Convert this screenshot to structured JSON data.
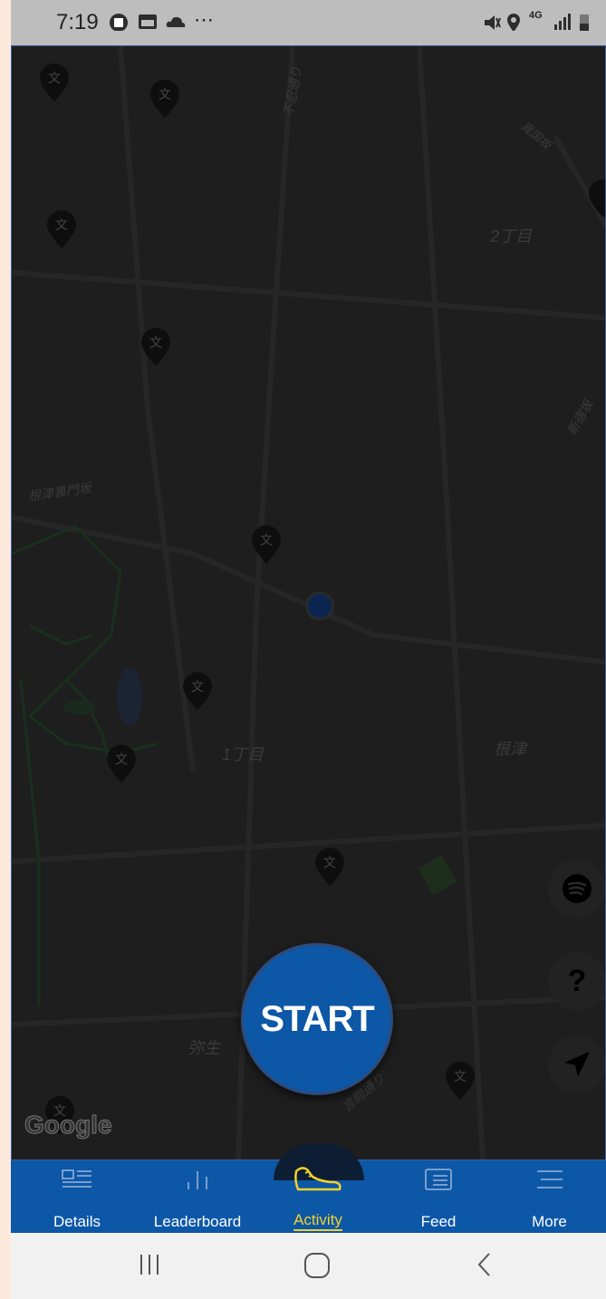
{
  "status_bar": {
    "time": "7:19",
    "net": "4G"
  },
  "map": {
    "labels": [
      "2丁目",
      "根津裏門坂",
      "1丁目",
      "根津",
      "弥生",
      "言問通り",
      "不忍通り",
      "新宿坂",
      "異国坂"
    ],
    "attribution": "Google"
  },
  "start_button": {
    "label": "START"
  },
  "bottom_nav": {
    "items": [
      {
        "label": "Details"
      },
      {
        "label": "Leaderboard"
      },
      {
        "label": "Activity"
      },
      {
        "label": "Feed"
      },
      {
        "label": "More"
      }
    ],
    "active": "Activity"
  },
  "colors": {
    "brand": "#0d57a7",
    "active": "#f2d12a",
    "map_bg": "#1e1e1e"
  }
}
